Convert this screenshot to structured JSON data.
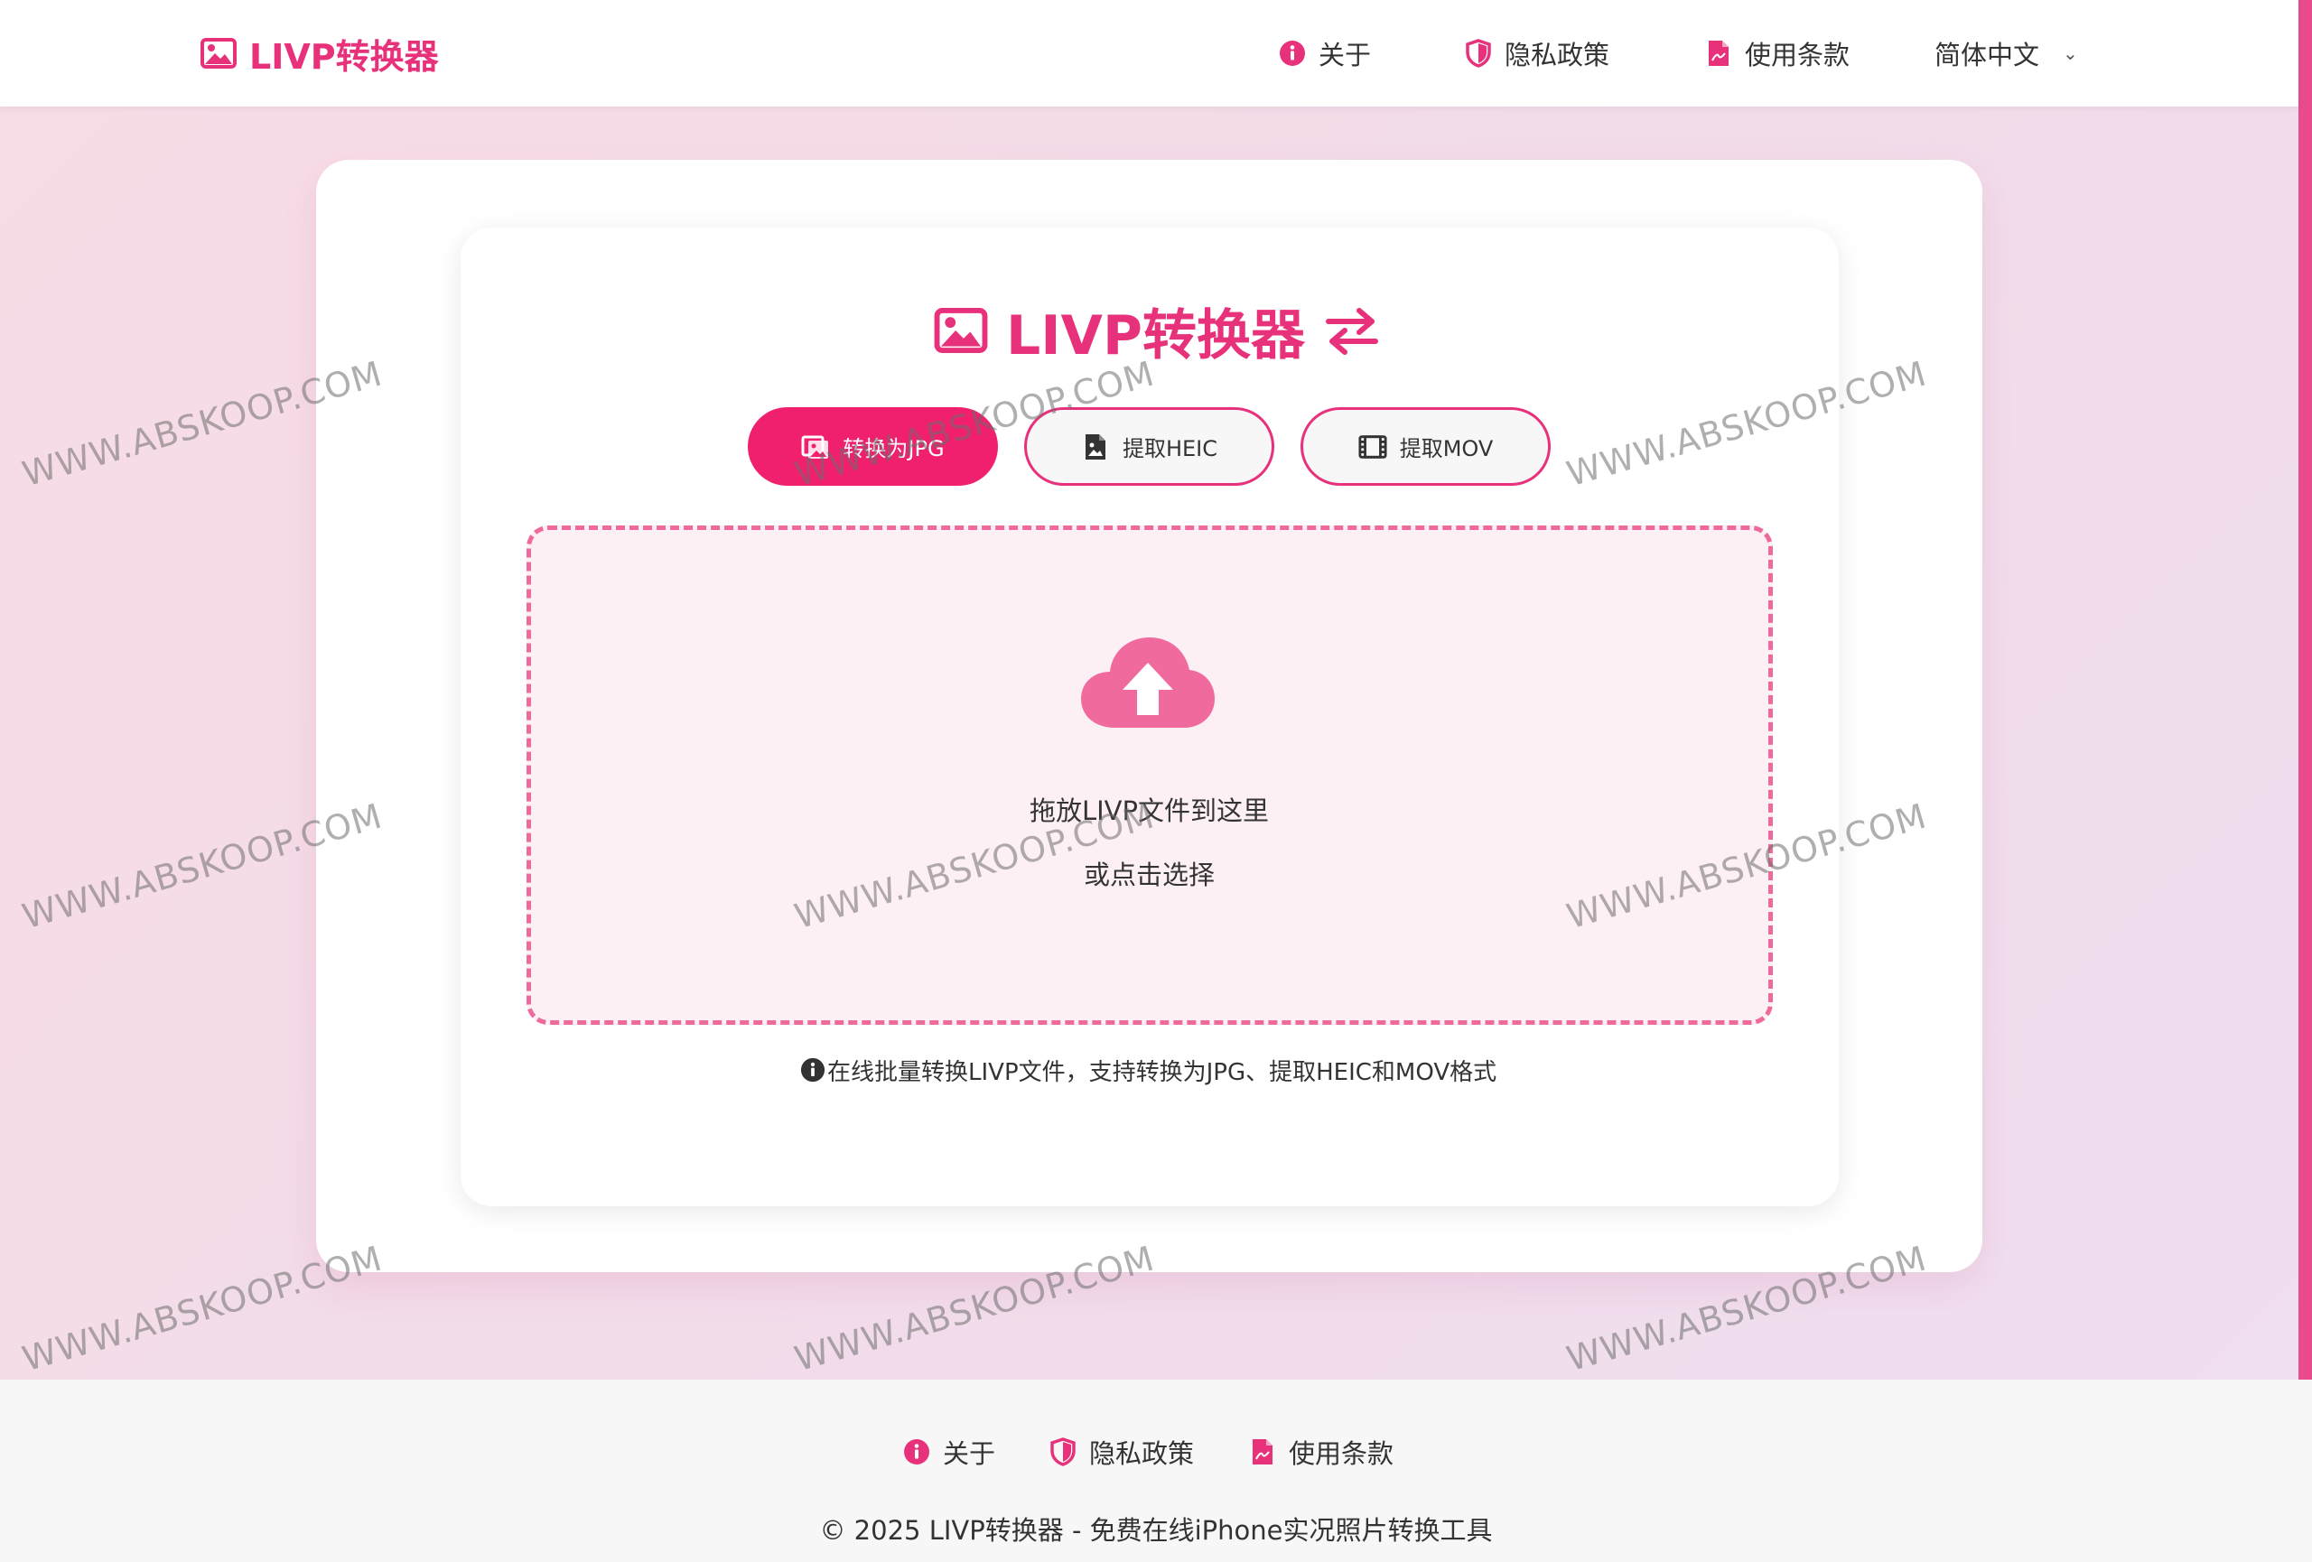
{
  "header": {
    "brand": "LIVP转换器",
    "nav": {
      "about": "关于",
      "privacy": "隐私政策",
      "terms": "使用条款"
    },
    "language": "简体中文"
  },
  "main": {
    "title": "LIVP转换器",
    "modes": {
      "jpg": "转换为JPG",
      "heic": "提取HEIC",
      "mov": "提取MOV"
    },
    "active_mode": "jpg",
    "dropzone": {
      "line1": "拖放LIVP文件到这里",
      "line2": "或点击选择"
    },
    "helper": "在线批量转换LIVP文件，支持转换为JPG、提取HEIC和MOV格式"
  },
  "footer": {
    "about": "关于",
    "privacy": "隐私政策",
    "terms": "使用条款",
    "copyright": "© 2025 LIVP转换器 - 免费在线iPhone实况照片转换工具"
  },
  "watermark": "WWW.ABSKOOP.COM",
  "colors": {
    "accent": "#e8317b",
    "button_active": "#f0206e",
    "dropzone_border": "#ef6a9c",
    "dropzone_bg": "#fdf0f4"
  }
}
